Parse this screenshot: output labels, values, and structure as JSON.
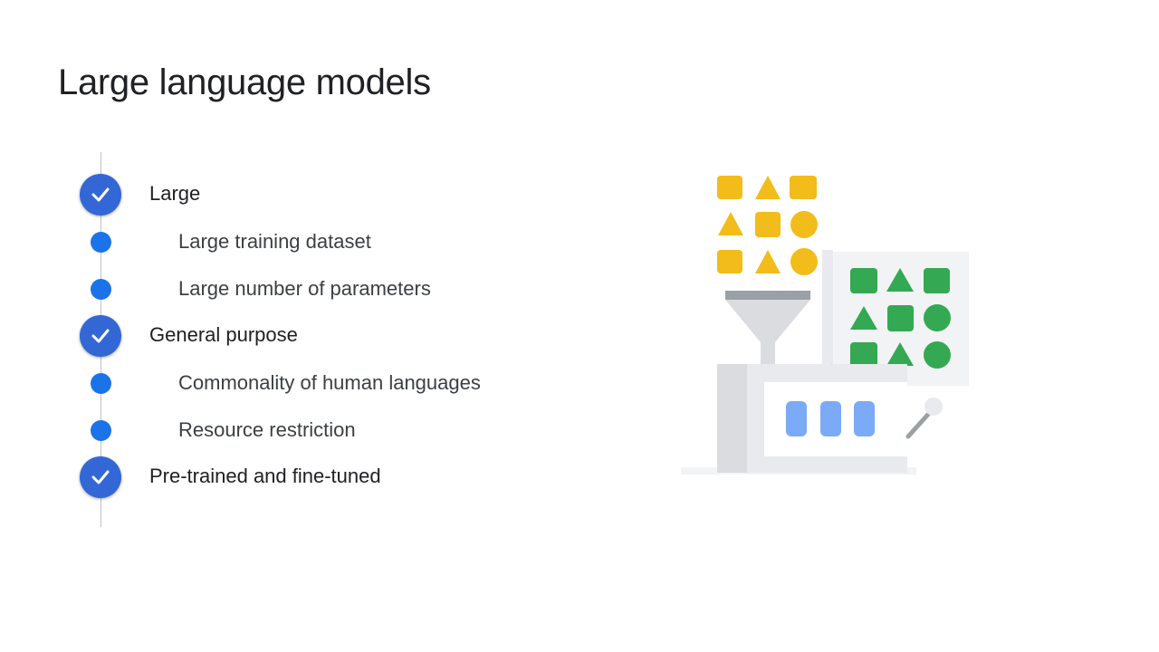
{
  "slide": {
    "title": "Large language models"
  },
  "timeline": {
    "items": [
      {
        "level": "main",
        "label": "Large",
        "marker": "check-circle-icon"
      },
      {
        "level": "sub",
        "label": "Large training dataset",
        "marker": "dot-icon"
      },
      {
        "level": "sub",
        "label": "Large number of parameters",
        "marker": "dot-icon"
      },
      {
        "level": "main",
        "label": "General purpose",
        "marker": "check-circle-icon"
      },
      {
        "level": "sub",
        "label": "Commonality of human languages",
        "marker": "dot-icon"
      },
      {
        "level": "sub",
        "label": "Resource restriction",
        "marker": "dot-icon"
      },
      {
        "level": "main",
        "label": "Pre-trained and fine-tuned",
        "marker": "check-circle-icon"
      }
    ]
  },
  "colors": {
    "accent_blue": "#1a73e8",
    "check_blue": "#3367d6",
    "shape_yellow": "#f2bc1b",
    "shape_green": "#34a853",
    "tile_blue": "#7baaf7",
    "machine_gray": "#e8eaed"
  },
  "illustration": {
    "icon": "factory-machine-illustration"
  }
}
